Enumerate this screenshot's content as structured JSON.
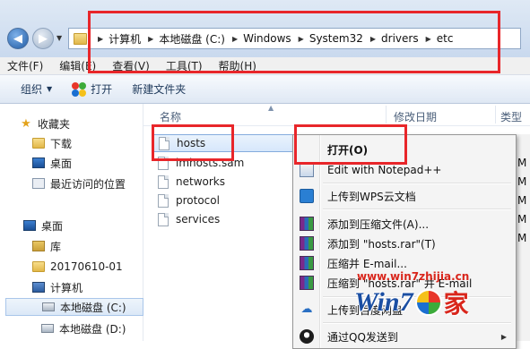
{
  "address_bar": {
    "crumbs": [
      "计算机",
      "本地磁盘 (C:)",
      "Windows",
      "System32",
      "drivers",
      "etc"
    ]
  },
  "menu": [
    "文件(F)",
    "编辑(E)",
    "查看(V)",
    "工具(T)",
    "帮助(H)"
  ],
  "toolbar": {
    "organize": "组织",
    "open": "打开",
    "new_folder": "新建文件夹"
  },
  "nav": {
    "favorites": "收藏夹",
    "downloads": "下载",
    "desktop_fav": "桌面",
    "recent": "最近访问的位置",
    "desktop": "桌面",
    "library": "库",
    "user_folder": "20170610-01",
    "computer": "计算机",
    "drive_c": "本地磁盘 (C:)",
    "drive_d": "本地磁盘 (D:)"
  },
  "columns": {
    "name": "名称",
    "modified": "修改日期",
    "type": "类型"
  },
  "files": [
    "hosts",
    "lmhosts.sam",
    "networks",
    "protocol",
    "services"
  ],
  "context_menu": {
    "open": "打开(O)",
    "edit_notepad": "Edit with Notepad++",
    "upload_wps": "上传到WPS云文档",
    "add_archive": "添加到压缩文件(A)...",
    "add_hosts_rar": "添加到 \"hosts.rar\"(T)",
    "compress_email": "压缩并 E-mail...",
    "compress_to_rar_email": "压缩到 \"hosts.rar\" 并 E-mail",
    "upload_baidu": "上传到百度网盘",
    "send_qq": "通过QQ发送到"
  },
  "right_clip": [
    "M",
    "M",
    "M",
    "M",
    "M"
  ],
  "watermark": {
    "url": "www.win7zhijia.cn",
    "logo_text": "Win7",
    "logo_suffix": "家"
  },
  "colors": {
    "highlight": "#e8262a",
    "accent": "#1b4fa3"
  }
}
